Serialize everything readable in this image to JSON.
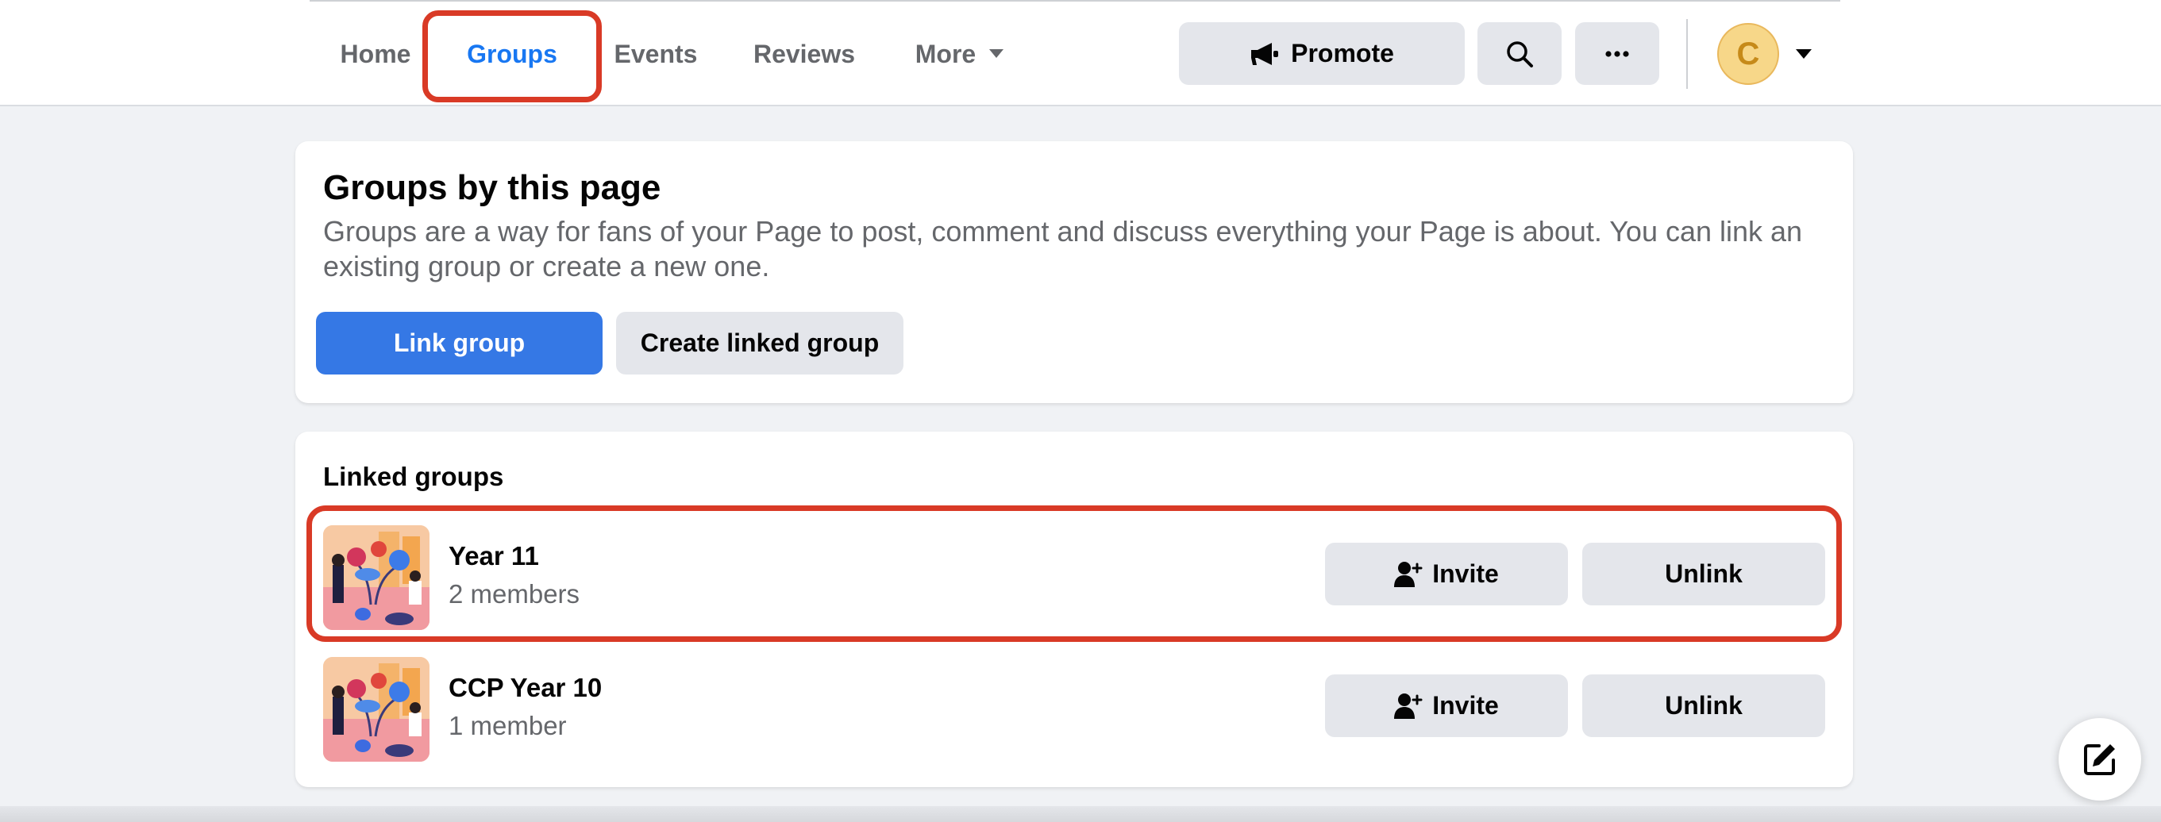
{
  "nav": {
    "tabs": [
      {
        "label": "Home"
      },
      {
        "label": "Groups"
      },
      {
        "label": "Events"
      },
      {
        "label": "Reviews"
      },
      {
        "label": "More"
      }
    ],
    "active_tab": "Groups",
    "promote_label": "Promote",
    "avatar_letter": "C"
  },
  "groups_card": {
    "title": "Groups by this page",
    "description": "Groups are a way for fans of your Page to post, comment and discuss everything your Page is about. You can link an existing group or create a new one.",
    "link_button": "Link group",
    "create_button": "Create linked group"
  },
  "linked": {
    "heading": "Linked groups",
    "groups": [
      {
        "name": "Year 11",
        "members": "2 members",
        "invite_label": "Invite",
        "unlink_label": "Unlink"
      },
      {
        "name": "CCP Year 10",
        "members": "1 member",
        "invite_label": "Invite",
        "unlink_label": "Unlink"
      }
    ]
  },
  "colors": {
    "accent": "#1877f2",
    "primary_button": "#3578e5",
    "highlight": "#d93a26",
    "gray_button": "#e4e6eb"
  },
  "icons": [
    "megaphone-icon",
    "search-icon",
    "ellipsis-icon",
    "caret-down-icon",
    "add-person-icon",
    "compose-icon"
  ]
}
